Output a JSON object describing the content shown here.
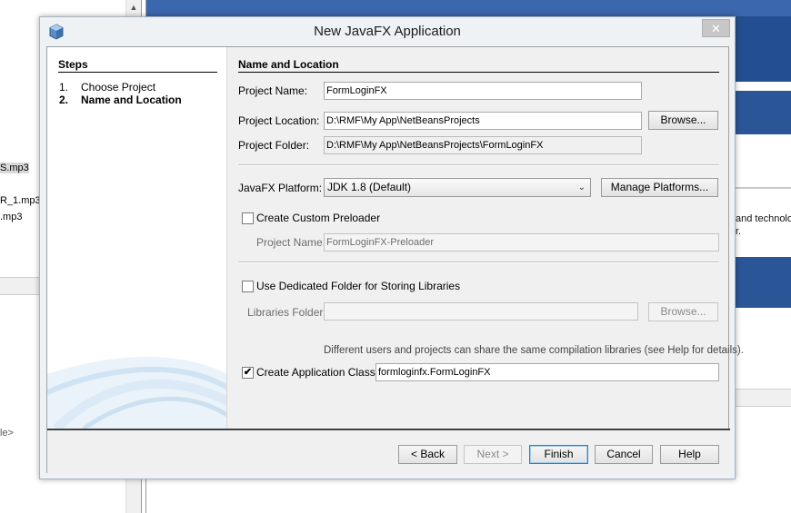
{
  "background": {
    "files": [
      "S.mp3",
      "R_1.mp3",
      ".mp3"
    ],
    "misc_text": "le>",
    "right_text_1": "and technolo",
    "right_text_2": "r.",
    "colors": {
      "banner_blue": "#234e8f"
    }
  },
  "dialog": {
    "title": "New JavaFX Application",
    "close_glyph": "✕",
    "steps": {
      "heading": "Steps",
      "items": [
        {
          "num": "1.",
          "label": "Choose Project"
        },
        {
          "num": "2.",
          "label": "Name and Location"
        }
      ]
    },
    "section_title": "Name and Location",
    "project_name": {
      "label": "Project Name:",
      "value": "FormLoginFX"
    },
    "project_location": {
      "label": "Project Location:",
      "value": "D:\\RMF\\My App\\NetBeansProjects",
      "browse": "Browse..."
    },
    "project_folder": {
      "label": "Project Folder:",
      "value": "D:\\RMF\\My App\\NetBeansProjects\\FormLoginFX"
    },
    "platform": {
      "label": "JavaFX Platform:",
      "selected": "JDK 1.8 (Default)",
      "manage": "Manage Platforms..."
    },
    "preloader": {
      "checkbox_label": "Create Custom Preloader",
      "checked": false,
      "name_label": "Project Name:",
      "name_value": "FormLoginFX-Preloader"
    },
    "libraries": {
      "checkbox_label": "Use Dedicated Folder for Storing Libraries",
      "checked": false,
      "folder_label": "Libraries Folder:",
      "folder_value": "",
      "browse": "Browse...",
      "info": "Different users and projects can share the same compilation libraries (see Help for details)."
    },
    "app_class": {
      "checkbox_label": "Create Application Class",
      "checked": true,
      "value": "formloginfx.FormLoginFX"
    },
    "buttons": {
      "back": "< Back",
      "next": "Next >",
      "finish": "Finish",
      "cancel": "Cancel",
      "help": "Help"
    }
  }
}
